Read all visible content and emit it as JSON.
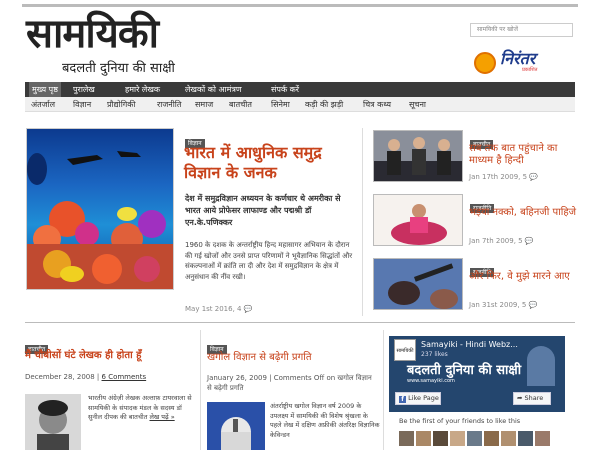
{
  "header": {
    "logo_main": "सामयिकी",
    "logo_sub": "बदलती दुनिया की साक्षी",
    "search_placeholder": "सामयिकी पर खोजें",
    "sponsor_name": "निरंतर",
    "sponsor_sub": "प्रकाशित"
  },
  "nav_primary": [
    "मुख्य पृष्ठ",
    "पुरालेख",
    "हमारे लेखक",
    "लेखकों को आमंत्रण",
    "संपर्क करें"
  ],
  "nav_secondary": [
    "अंतर्जाल",
    "विज्ञान",
    "प्रौद्योगिकी",
    "राजनीति",
    "समाज",
    "बातचीत",
    "सिनेमा",
    "कड़ी की झड़ी",
    "चित्र कथ्य",
    "सूचना"
  ],
  "featured": {
    "tag": "विज्ञान",
    "title": "भारत में आधुनिक समुद्र विज्ञान के जनक",
    "lead": "देश में समुद्रविज्ञान अध्ययन के कर्णधार थे अमरीका से भारत आये प्रोफेसर लाफाण्ड और पद्मश्री डॉ एन.के.पणिक्कर",
    "body": "1960 के दशक के अन्तर्राष्ट्रीय हिन्द महासागर अभियान के दौरान की गई खोजों और उनसे प्राप्त परिणामों ने भूवैज्ञानिक सिद्धांतों और संकल्पनाओं में क्रांति ला दी और देश में समुद्रविज्ञान के क्षेत्र में अनुसंधान की नींव रखी।",
    "date": "May 1st 2016,",
    "comments": "4"
  },
  "side_posts": [
    {
      "tag": "बातचीत",
      "title": "सब तक बात पहुंचाने का माध्यम है हिन्दी",
      "date": "Jan 17th 2009,",
      "comments": "5"
    },
    {
      "tag": "राजनीति",
      "title": "भइया नक्को, बहिनजी पाहिजे",
      "date": "Jan 7th 2009,",
      "comments": "5"
    },
    {
      "tag": "राजनीति",
      "title": "और फिर, वे मुझे मारने आए",
      "date": "Jan 31st 2009,",
      "comments": "5"
    }
  ],
  "bottom_posts": [
    {
      "tag": "बातचीत",
      "title": "मैं चौबीसों घंटे लेखक ही होता हूँ",
      "date": "December 28, 2008",
      "sep": " | ",
      "comments_link": "6 Comments",
      "excerpt": "भारतीय अंग्रेज़ी लेखक अल्ताफ़ टायरवाला से सामयिकी के संपादक मंडल के सदस्य डॉ सुनील दीपक की बातचीत",
      "read_more": "लेख पढ़ें »"
    },
    {
      "tag": "विज्ञान",
      "title": "खगोल विज्ञान से बढ़ेगी प्रगति",
      "date": "January 26, 2009",
      "sep": " | ",
      "comments_off": "Comments Off",
      "comments_off_suffix": " on खगोल विज्ञान से बढ़ेगी प्रगति",
      "excerpt": "अंतर्राष्ट्रीय खगोल विज्ञान वर्ष 2009 के उपलक्ष्य में सामयिकी की विशेष श्रृंखला के पहले लेख में दक्षिण अफ्रीकी अंतरिक्ष विज्ञानिक केविन्डन"
    }
  ],
  "fb_widget": {
    "page_name": "Samayiki - Hindi Webz...",
    "likes": "237 likes",
    "banner_text": "बदलती दुनिया की साक्षी",
    "url": "www.samayiki.com",
    "like_button": "Like Page",
    "share_button": "Share",
    "friends_text": "Be the first of your friends to like this"
  },
  "colors": {
    "accent": "#c8431b",
    "nav_dark": "#3a3a3a",
    "fb_blue": "#4267b2"
  }
}
